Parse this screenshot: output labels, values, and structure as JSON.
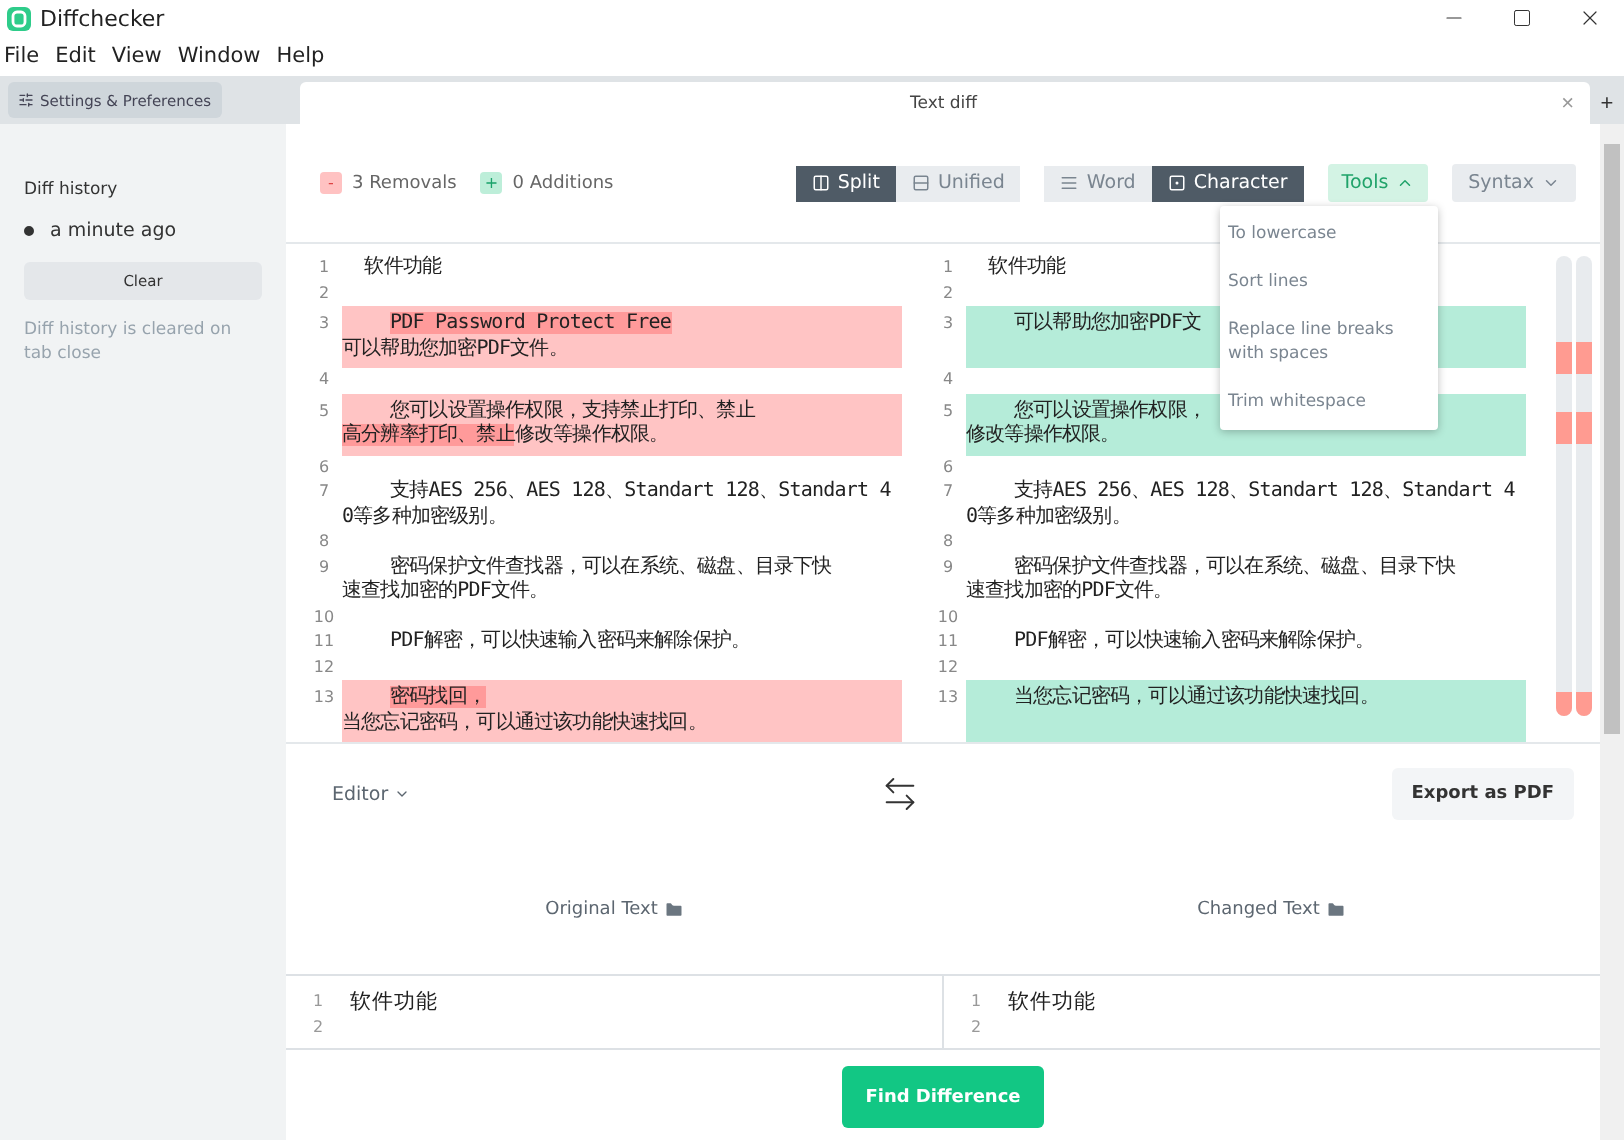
{
  "window": {
    "title": "Diffchecker"
  },
  "menu": [
    "File",
    "Edit",
    "View",
    "Window",
    "Help"
  ],
  "settings_button": "Settings & Preferences",
  "tab": {
    "title": "Text diff",
    "close": "×"
  },
  "new_tab": "+",
  "sidebar": {
    "heading": "Diff history",
    "history": [
      {
        "label": "a minute ago",
        "selected": true
      }
    ],
    "clear_button": "Clear",
    "note": "Diff history is cleared on tab close"
  },
  "summary": {
    "removals": {
      "sign": "-",
      "label": "3 Removals"
    },
    "additions": {
      "sign": "+",
      "label": "0 Additions"
    }
  },
  "view_modes": [
    {
      "label": "Split",
      "selected": true
    },
    {
      "label": "Unified",
      "selected": false
    }
  ],
  "precision": [
    {
      "label": "Word",
      "selected": false
    },
    {
      "label": "Character",
      "selected": true
    }
  ],
  "tools": {
    "label": "Tools",
    "expanded": true,
    "items": [
      "To lowercase",
      "Sort lines",
      "Replace line breaks with spaces",
      "Trim whitespace"
    ]
  },
  "syntax": {
    "label": "Syntax"
  },
  "left_pane": [
    {
      "num": "1",
      "highlighted": false,
      "indent": false,
      "rows": [
        [
          {
            "text": "  软件功能",
            "strong": false
          }
        ]
      ]
    },
    {
      "num": "2",
      "highlighted": false
    },
    {
      "num": "3",
      "highlighted": true,
      "indent": true,
      "rows": [
        [
          {
            "text": "PDF Password Protect Free",
            "strong": true
          }
        ],
        [
          {
            "text": "可以帮助您加密PDF文件。",
            "strong": false
          }
        ]
      ]
    },
    {
      "num": "4",
      "highlighted": false
    },
    {
      "num": "5",
      "highlighted": true,
      "indent": true,
      "rows": [
        [
          {
            "text": "您可以设置操作权限，支持禁止打印、禁止",
            "strong": false
          }
        ],
        [
          {
            "text": "高分辨率打印、禁止",
            "strong": true
          },
          {
            "text": "修改等操作权限。",
            "strong": false
          }
        ]
      ]
    },
    {
      "num": "6",
      "highlighted": false
    },
    {
      "num": "7",
      "highlighted": false,
      "indent": true,
      "rows": [
        [
          {
            "text": "支持AES 256、AES 128、Standart 128、Standart 4",
            "strong": false
          }
        ],
        [
          {
            "text": "0等多种加密级别。",
            "strong": false
          }
        ]
      ]
    },
    {
      "num": "8",
      "highlighted": false
    },
    {
      "num": "9",
      "highlighted": false,
      "indent": true,
      "rows": [
        [
          {
            "text": "密码保护文件查找器，可以在系统、磁盘、目录下快",
            "strong": false
          }
        ],
        [
          {
            "text": "速查找加密的PDF文件。",
            "strong": false
          }
        ]
      ]
    },
    {
      "num": "10",
      "highlighted": false
    },
    {
      "num": "11",
      "highlighted": false,
      "indent": true,
      "rows": [
        [
          {
            "text": "PDF解密，可以快速输入密码来解除保护。",
            "strong": false
          }
        ]
      ]
    },
    {
      "num": "12",
      "highlighted": false
    },
    {
      "num": "13",
      "highlighted": true,
      "indent": true,
      "rows": [
        [
          {
            "text": "密码找回，",
            "strong": true
          }
        ],
        [
          {
            "text": "当您忘记密码，可以通过该功能快速找回。",
            "strong": false
          }
        ]
      ]
    }
  ],
  "right_pane": [
    {
      "num": "1",
      "highlighted": false,
      "indent": false,
      "rows": [
        [
          {
            "text": "  软件功能",
            "strong": false
          }
        ]
      ]
    },
    {
      "num": "2",
      "highlighted": false
    },
    {
      "num": "3",
      "highlighted": true,
      "indent": true,
      "rows": [
        [
          {
            "text": "可以帮助您加密PDF文",
            "strong": false
          }
        ]
      ]
    },
    {
      "num": "4",
      "highlighted": false
    },
    {
      "num": "5",
      "highlighted": true,
      "indent": true,
      "rows": [
        [
          {
            "text": "您可以设置操作权限，",
            "strong": false
          }
        ],
        [
          {
            "text": "修改等操作权限。",
            "strong": false
          }
        ]
      ]
    },
    {
      "num": "6",
      "highlighted": false
    },
    {
      "num": "7",
      "highlighted": false,
      "indent": true,
      "rows": [
        [
          {
            "text": "支持AES 256、AES 128、Standart 128、Standart 4",
            "strong": false
          }
        ],
        [
          {
            "text": "0等多种加密级别。",
            "strong": false
          }
        ]
      ]
    },
    {
      "num": "8",
      "highlighted": false
    },
    {
      "num": "9",
      "highlighted": false,
      "indent": true,
      "rows": [
        [
          {
            "text": "密码保护文件查找器，可以在系统、磁盘、目录下快",
            "strong": false
          }
        ],
        [
          {
            "text": "速查找加密的PDF文件。",
            "strong": false
          }
        ]
      ]
    },
    {
      "num": "10",
      "highlighted": false
    },
    {
      "num": "11",
      "highlighted": false,
      "indent": true,
      "rows": [
        [
          {
            "text": "PDF解密，可以快速输入密码来解除保护。",
            "strong": false
          }
        ]
      ]
    },
    {
      "num": "12",
      "highlighted": false
    },
    {
      "num": "13",
      "highlighted": true,
      "indent": true,
      "rows": [
        [
          {
            "text": "当您忘记密码，可以通过该功能快速找回。",
            "strong": false
          }
        ]
      ]
    }
  ],
  "editor": {
    "mode": "Editor",
    "export_button": "Export as PDF",
    "original": {
      "label": "Original Text",
      "lines": [
        {
          "num": "1",
          "text": "软件功能"
        },
        {
          "num": "2"
        }
      ]
    },
    "changed": {
      "label": "Changed Text",
      "lines": [
        {
          "num": "1",
          "text": "软件功能"
        },
        {
          "num": "2"
        }
      ]
    }
  },
  "find_button": "Find Difference"
}
